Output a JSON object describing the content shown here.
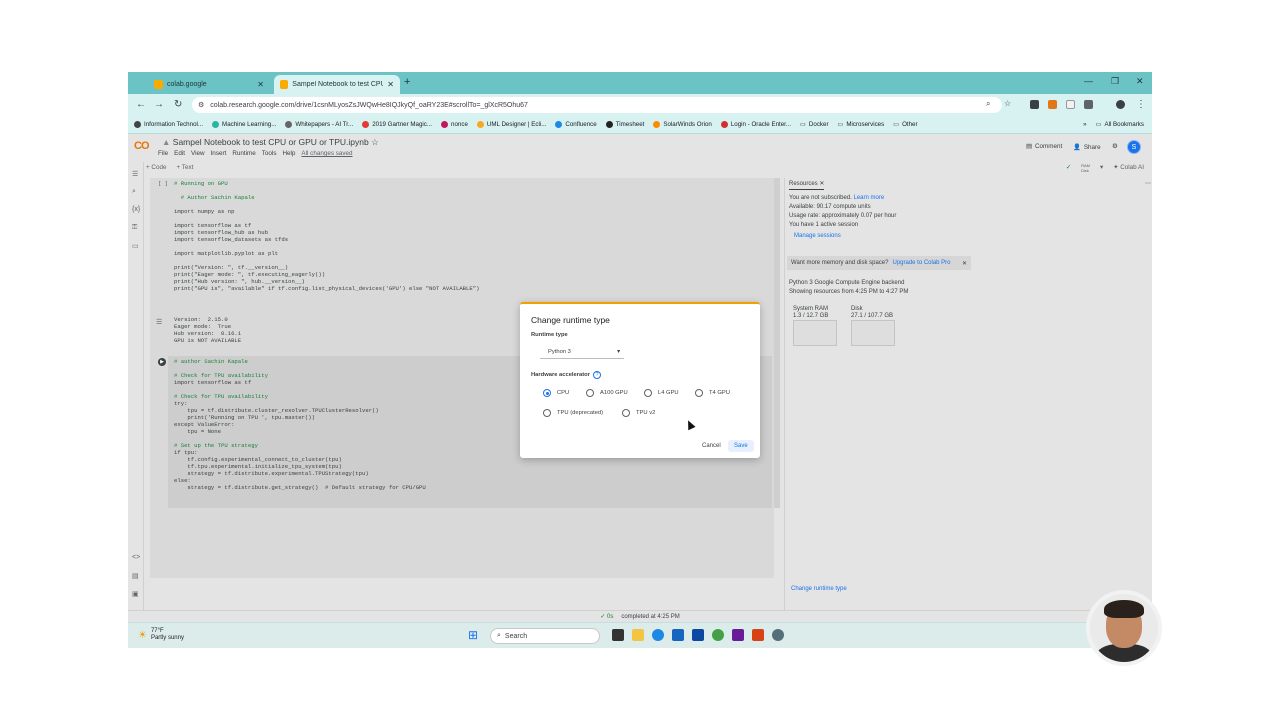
{
  "browser": {
    "tabs": [
      {
        "label": "colab.google",
        "active": false
      },
      {
        "label": "Sampel Notebook to test CPU c",
        "active": true
      }
    ],
    "url": "colab.research.google.com/drive/1csnMLyosZsJWQwHe8IQJkyQf_oaRY23E#scrollTo=_glXcR5Ohu67",
    "bookmarks": [
      "Information Technol...",
      "Machine Learning...",
      "Whitepapers - AI Tr...",
      "2019 Gartner Magic...",
      "nonce",
      "UML Designer | Ecli...",
      "Confluence",
      "Timesheet",
      "SolarWinds Orion",
      "Login - Oracle Enter...",
      "Docker",
      "Microservices",
      "Other"
    ],
    "all_bookmarks": "All Bookmarks"
  },
  "colab": {
    "logo": "CO",
    "title": "Sampel Notebook to test CPU or GPU or TPU.ipynb",
    "menu": [
      "File",
      "Edit",
      "View",
      "Insert",
      "Runtime",
      "Tools",
      "Help"
    ],
    "saved": "All changes saved",
    "comment": "Comment",
    "share": "Share",
    "avatar": "S",
    "add_code": "+ Code",
    "add_text": "+ Text",
    "ram_label": "RAM",
    "disk_label": "Disk",
    "colab_ai": "Colab AI",
    "cell1_bracket": "[ ]",
    "cell1_code": [
      "# Running on GPU",
      "",
      "  # Author Sachin Kapale",
      "",
      "import numpy as np",
      "",
      "import tensorflow as tf",
      "import tensorflow_hub as hub",
      "import tensorflow_datasets as tfds",
      "",
      "import matplotlib.pyplot as plt",
      "",
      "print(\"Version: \", tf.__version__)",
      "print(\"Eager mode: \", tf.executing_eagerly())",
      "print(\"Hub version: \", hub.__version__)",
      "print(\"GPU is\", \"available\" if tf.config.list_physical_devices('GPU') else \"NOT AVAILABLE\")"
    ],
    "cell1_output": [
      "Version:  2.15.0",
      "Eager mode:  True",
      "Hub version:  0.16.1",
      "GPU is NOT AVAILABLE"
    ],
    "cell2_code": [
      "# author Sachin Kapale",
      "",
      "# Check for TPU availability",
      "import tensorflow as tf",
      "",
      "# Check for TPU availability",
      "try:",
      "    tpu = tf.distribute.cluster_resolver.TPUClusterResolver()",
      "    print('Running on TPU ', tpu.master())",
      "except ValueError:",
      "    tpu = None",
      "",
      "# Set up the TPU strategy",
      "if tpu:",
      "    tf.config.experimental_connect_to_cluster(tpu)",
      "    tf.tpu.experimental.initialize_tpu_system(tpu)",
      "    strategy = tf.distribute.experimental.TPUStrategy(tpu)",
      "else:",
      "    strategy = tf.distribute.get_strategy()  # Default strategy for CPU/GPU"
    ],
    "status_check": "✓ 0s",
    "status_text": "completed at 4:25 PM"
  },
  "resources": {
    "tab": "Resources",
    "line1": "You are not subscribed.",
    "learn_more": "Learn more",
    "line2": "Available: 90.17 compute units",
    "line3": "Usage rate: approximately 0.07 per hour",
    "line4": "You have 1 active session",
    "manage": "Manage sessions",
    "promo": "Want more memory and disk space?",
    "promo_link": "Upgrade to Colab Pro",
    "backend": "Python 3 Google Compute Engine backend",
    "showing": "Showing resources from 4:25 PM to 4:27 PM",
    "ram_title": "System RAM",
    "ram_value": "1.3 / 12.7 GB",
    "disk_title": "Disk",
    "disk_value": "27.1 / 107.7 GB",
    "change_runtime": "Change runtime type"
  },
  "dialog": {
    "title": "Change runtime type",
    "runtime_label": "Runtime type",
    "runtime_value": "Python 3",
    "hw_label": "Hardware accelerator",
    "options": [
      "CPU",
      "A100 GPU",
      "L4 GPU",
      "T4 GPU",
      "TPU (deprecated)",
      "TPU v2"
    ],
    "selected": "CPU",
    "cancel": "Cancel",
    "save": "Save"
  },
  "taskbar": {
    "temp": "77°F",
    "weather": "Partly sunny",
    "search": "Search"
  }
}
